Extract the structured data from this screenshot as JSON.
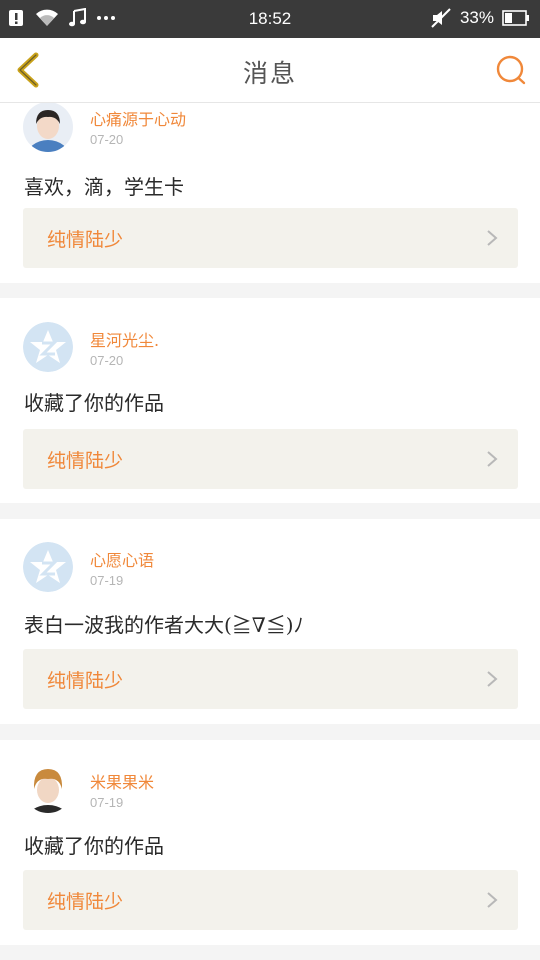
{
  "status_bar": {
    "time": "18:52",
    "battery": "33%",
    "icons": [
      "notification-icon",
      "wifi-icon",
      "music-icon",
      "more-dots-icon",
      "mute-icon",
      "battery-icon"
    ]
  },
  "header": {
    "title": "消息",
    "back_icon": "chevron-left-icon",
    "search_icon": "search-icon"
  },
  "messages": [
    {
      "user": "心痛源于心动",
      "date": "07-20",
      "text": "喜欢，滴，学生卡",
      "ref_title": "纯情陆少",
      "avatar": "photo-avatar"
    },
    {
      "user": "星河光尘.",
      "date": "07-20",
      "text": "收藏了你的作品",
      "ref_title": "纯情陆少",
      "avatar": "default-star-avatar"
    },
    {
      "user": "心愿心语",
      "date": "07-19",
      "text": "表白一波我的作者大大(≧∇≦)ﾉ",
      "ref_title": "纯情陆少",
      "avatar": "default-star-avatar"
    },
    {
      "user": "米果果米",
      "date": "07-19",
      "text": "收藏了你的作品",
      "ref_title": "纯情陆少",
      "avatar": "photo-avatar"
    }
  ],
  "colors": {
    "accent": "#f0883a",
    "back_icon": "#c9a21a",
    "statusbar": "#3a3a3a",
    "ref_bg": "#f3f2ec"
  }
}
